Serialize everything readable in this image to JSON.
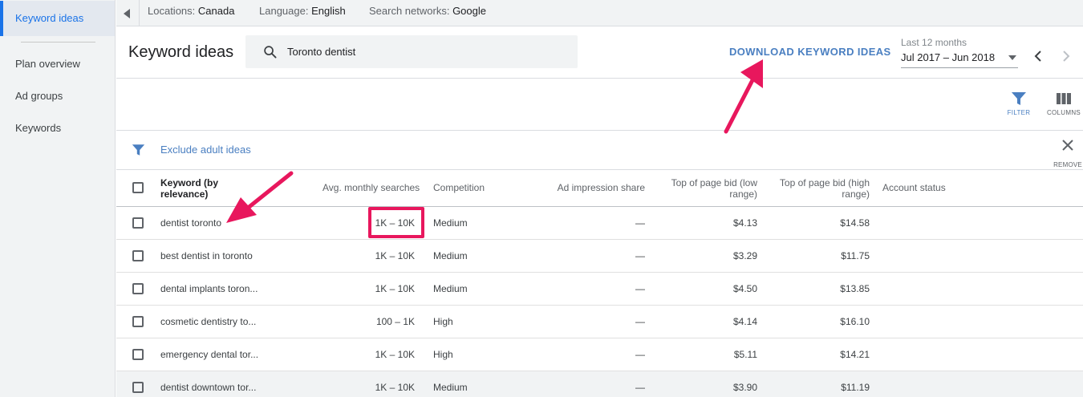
{
  "sidebar": {
    "items": [
      {
        "label": "Keyword ideas",
        "active": true
      },
      {
        "label": "Plan overview",
        "active": false
      },
      {
        "label": "Ad groups",
        "active": false
      },
      {
        "label": "Keywords",
        "active": false
      }
    ]
  },
  "topbar": {
    "locations_label": "Locations:",
    "locations_value": "Canada",
    "language_label": "Language:",
    "language_value": "English",
    "networks_label": "Search networks:",
    "networks_value": "Google"
  },
  "header": {
    "title": "Keyword ideas",
    "search_value": "Toronto dentist",
    "download_label": "DOWNLOAD KEYWORD IDEAS",
    "date_range_label": "Last 12 months",
    "date_range_value": "Jul 2017 – Jun 2018"
  },
  "toolbar": {
    "filter_label": "FILTER",
    "columns_label": "COLUMNS"
  },
  "filters": {
    "chip_label": "Exclude adult ideas",
    "remove_label": "REMOVE"
  },
  "table": {
    "columns": {
      "keyword": "Keyword (by relevance)",
      "searches": "Avg. monthly searches",
      "competition": "Competition",
      "impression": "Ad impression share",
      "bid_low": "Top of page bid (low range)",
      "bid_high": "Top of page bid (high range)",
      "status": "Account status"
    },
    "rows": [
      {
        "keyword": "dentist toronto",
        "searches": "1K – 10K",
        "competition": "Medium",
        "impression": "—",
        "bid_low": "$4.13",
        "bid_high": "$14.58"
      },
      {
        "keyword": "best dentist in toronto",
        "searches": "1K – 10K",
        "competition": "Medium",
        "impression": "—",
        "bid_low": "$3.29",
        "bid_high": "$11.75"
      },
      {
        "keyword": "dental implants toron...",
        "searches": "1K – 10K",
        "competition": "Medium",
        "impression": "—",
        "bid_low": "$4.50",
        "bid_high": "$13.85"
      },
      {
        "keyword": "cosmetic dentistry to...",
        "searches": "100 – 1K",
        "competition": "High",
        "impression": "—",
        "bid_low": "$4.14",
        "bid_high": "$16.10"
      },
      {
        "keyword": "emergency dental tor...",
        "searches": "1K – 10K",
        "competition": "High",
        "impression": "—",
        "bid_low": "$5.11",
        "bid_high": "$14.21"
      },
      {
        "keyword": "dentist downtown tor...",
        "searches": "1K – 10K",
        "competition": "Medium",
        "impression": "—",
        "bid_low": "$3.90",
        "bid_high": "$11.19"
      }
    ]
  },
  "colors": {
    "accent": "#4a7fc1",
    "active_nav": "#1a73e8",
    "annotation": "#e8175d"
  }
}
